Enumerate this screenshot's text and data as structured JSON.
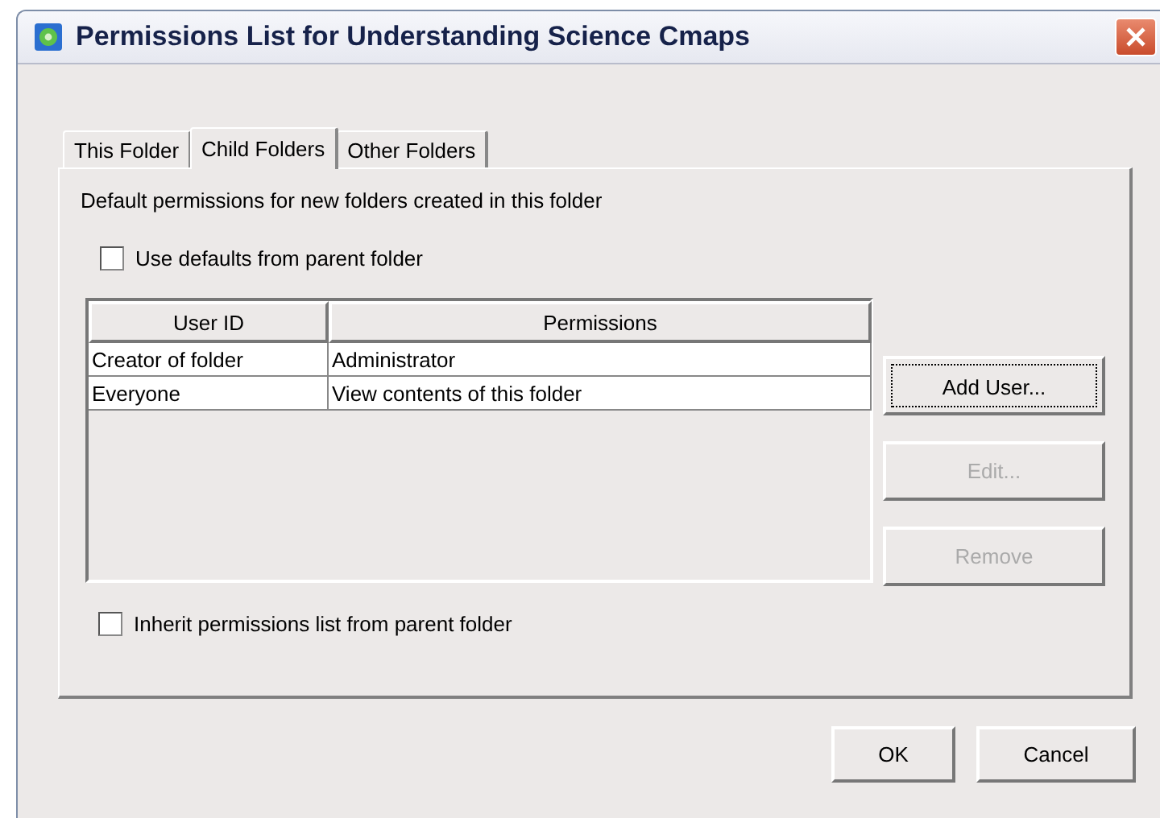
{
  "window": {
    "title": "Permissions List for Understanding Science Cmaps"
  },
  "tabs": [
    {
      "label": "This Folder",
      "selected": false
    },
    {
      "label": "Child Folders",
      "selected": true
    },
    {
      "label": "Other Folders",
      "selected": false
    }
  ],
  "description": "Default permissions for new folders created in this folder",
  "use_defaults": {
    "label": "Use defaults from parent folder",
    "checked": false
  },
  "table": {
    "columns": [
      "User ID",
      "Permissions"
    ],
    "rows": [
      [
        "Creator of folder",
        "Administrator"
      ],
      [
        "Everyone",
        "View contents of this folder"
      ]
    ]
  },
  "side_buttons": [
    {
      "label": "Add User...",
      "disabled": false,
      "focused": true
    },
    {
      "label": "Edit...",
      "disabled": true,
      "focused": false
    },
    {
      "label": "Remove",
      "disabled": true,
      "focused": false
    }
  ],
  "inherit": {
    "label": "Inherit permissions list from parent folder",
    "checked": false
  },
  "buttons": [
    "OK",
    "Cancel"
  ]
}
